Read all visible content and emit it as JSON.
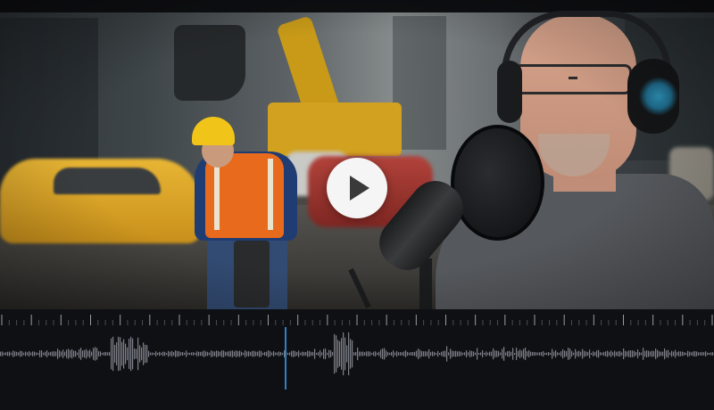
{
  "player": {
    "play_icon": "play-icon",
    "colors": {
      "play_button_bg": "#f5f5f5",
      "play_glyph": "#3a3a3a",
      "playhead": "#2f7fc1",
      "waveform": "#7d8088",
      "timeline_bg": "#0f1014"
    }
  },
  "timeline": {
    "progress": 0.4,
    "ruler_major_ticks": 24
  }
}
